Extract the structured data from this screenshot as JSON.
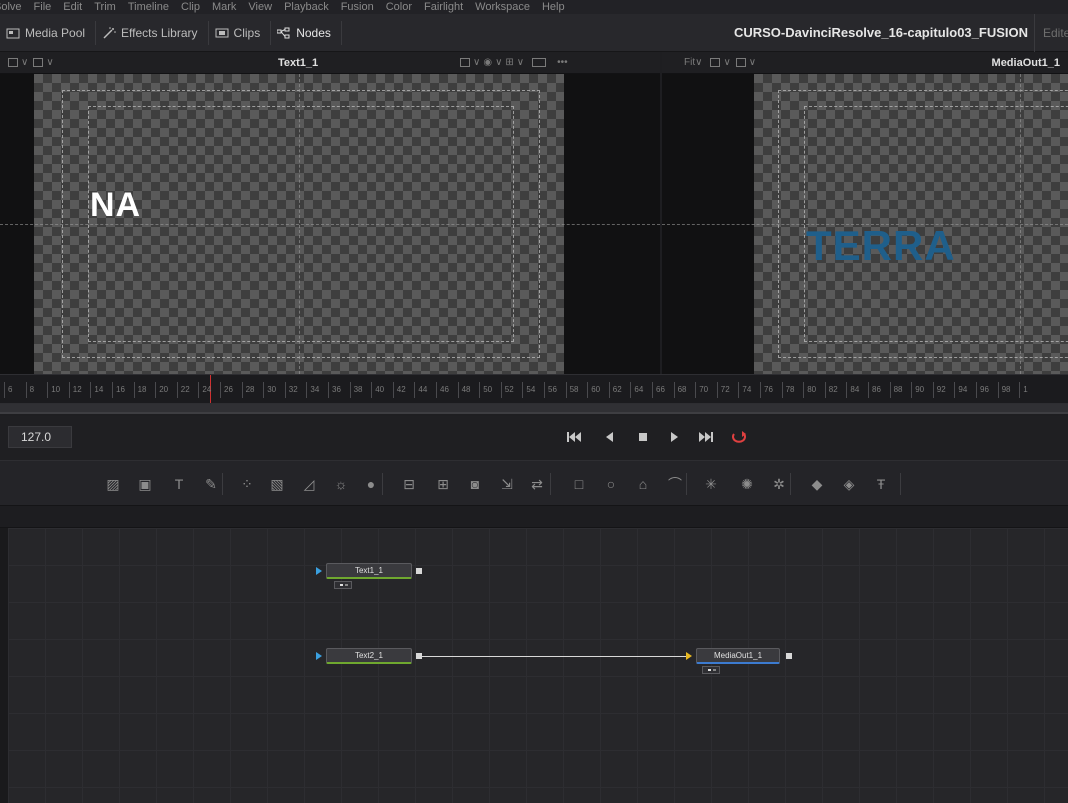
{
  "menu": {
    "items": [
      "Solve",
      "File",
      "Edit",
      "Trim",
      "Timeline",
      "Clip",
      "Mark",
      "View",
      "Playback",
      "Fusion",
      "Color",
      "Fairlight",
      "Workspace",
      "Help"
    ]
  },
  "toolbar": {
    "media_pool": "Media Pool",
    "effects_library": "Effects Library",
    "clips": "Clips",
    "nodes": "Nodes",
    "project_title": "CURSO-DavinciResolve_16-capitulo03_FUSION",
    "project_status": "Edited"
  },
  "viewer_left": {
    "title": "Text1_1",
    "text": "NA"
  },
  "viewer_right": {
    "zoom": "Fit",
    "title": "MediaOut1_1",
    "text": "TERRA",
    "text_color": "#1f5f8b"
  },
  "ruler": {
    "ticks": [
      "6",
      "8",
      "10",
      "12",
      "14",
      "16",
      "18",
      "20",
      "22",
      "24",
      "26",
      "28",
      "30",
      "32",
      "34",
      "36",
      "38",
      "40",
      "42",
      "44",
      "46",
      "48",
      "50",
      "52",
      "54",
      "56",
      "58",
      "60",
      "62",
      "64",
      "66",
      "68",
      "70",
      "72",
      "74",
      "76",
      "78",
      "80",
      "82",
      "84",
      "86",
      "88",
      "90",
      "92",
      "94",
      "96",
      "98",
      "1"
    ],
    "playhead_color": "#d03030"
  },
  "transport": {
    "current_frame": "127.0"
  },
  "tools": [
    "background-icon",
    "image-plane-icon",
    "text-icon",
    "paint-icon",
    "particles-icon",
    "grid-warp-icon",
    "polygon-mask-icon",
    "brightness-icon",
    "color-drop-icon",
    "loader-icon",
    "saver-icon",
    "merge-icon",
    "resize-icon",
    "transform-icon",
    "rectangle-mask-icon",
    "ellipse-mask-icon",
    "polygon-icon",
    "bspline-icon",
    "particle-emitter-icon",
    "particle-render-icon",
    "particle-mask-icon",
    "shape3d-icon",
    "renderer3d-icon",
    "text3d-icon"
  ],
  "nodes": {
    "text1": "Text1_1",
    "text2": "Text2_1",
    "media_out": "MediaOut1_1"
  }
}
